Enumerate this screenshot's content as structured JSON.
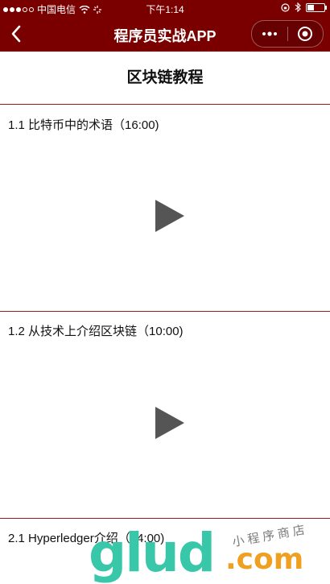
{
  "statusbar": {
    "carrier": "中国电信",
    "time": "下午1:14"
  },
  "navbar": {
    "title": "程序员实战APP"
  },
  "page": {
    "title": "区块链教程"
  },
  "lessons": [
    {
      "title": "1.1 比特币中的术语（16:00)"
    },
    {
      "title": "1.2 从技术上介绍区块链（10:00)"
    },
    {
      "title": "2.1 Hyperledger介绍（14:00)"
    }
  ],
  "watermark": {
    "brand": "glud",
    "domain": ".com",
    "tagline": "小程序商店"
  },
  "colors": {
    "accent": "#7a0000",
    "divider": "#9b1b1b",
    "play": "#555555"
  }
}
